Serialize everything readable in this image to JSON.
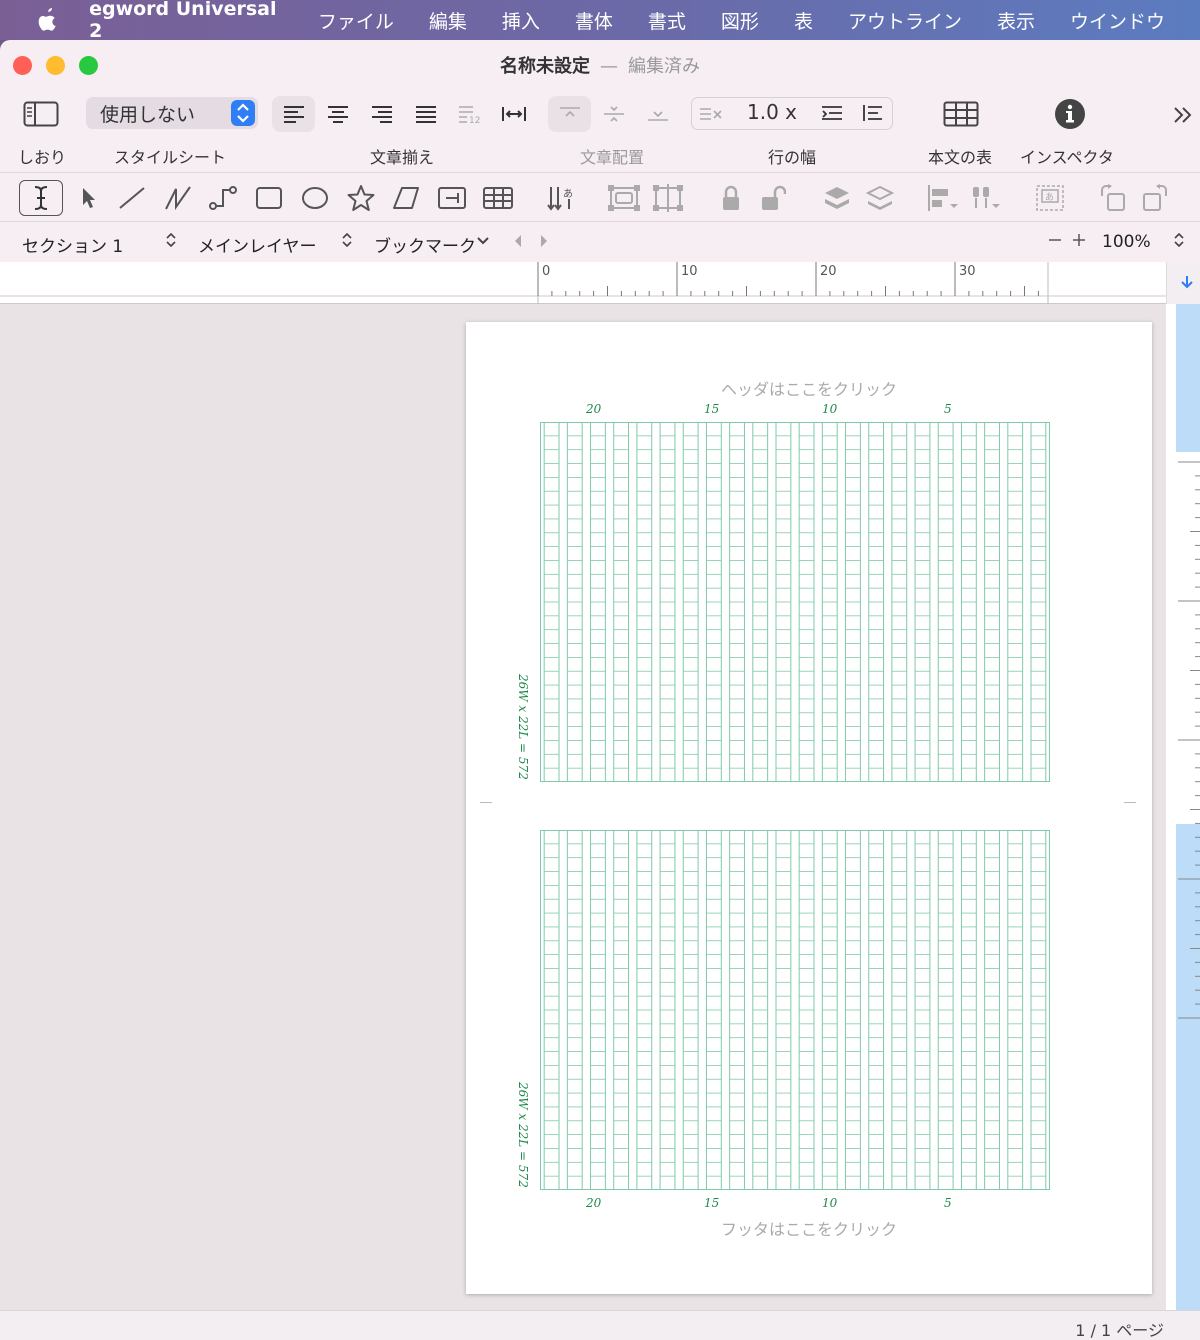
{
  "menubar": {
    "app_name": "egword Universal 2",
    "items": [
      "ファイル",
      "編集",
      "挿入",
      "書体",
      "書式",
      "図形",
      "表",
      "アウトライン",
      "表示",
      "ウインドウ"
    ]
  },
  "window": {
    "title": "名称未設定",
    "separator": "—",
    "subtitle": "編集済み"
  },
  "toolbar": {
    "bookmark_label": "しおり",
    "stylesheet_label": "スタイルシート",
    "stylesheet_value": "使用しない",
    "alignment_label": "文章揃え",
    "placement_label": "文章配置",
    "line_width_label": "行の幅",
    "line_spacing_value": "1.0 x",
    "table_label": "本文の表",
    "inspector_label": "インスペクタ"
  },
  "navbar": {
    "section": "セクション 1",
    "layer": "メインレイヤー",
    "bookmark": "ブックマーク",
    "zoom": "100%"
  },
  "ruler": {
    "ticks": [
      "0",
      "10",
      "20",
      "30"
    ]
  },
  "page": {
    "header_hint": "ヘッダはここをクリック",
    "footer_hint": "フッタはここをクリック",
    "column_numbers": [
      "20",
      "15",
      "10",
      "5"
    ],
    "grid_count": "26W x 22L = 572"
  },
  "status": {
    "page_count": "1 / 1 ページ"
  },
  "colors": {
    "accent": "#2f7ef5",
    "grid_line": "#7fcaa8",
    "grid_text": "#1d8a4a",
    "close": "#ff5f57",
    "minimize": "#febc2e",
    "zoom": "#28c840"
  }
}
